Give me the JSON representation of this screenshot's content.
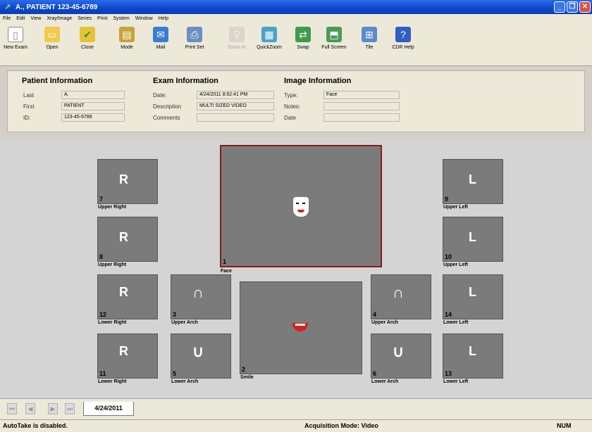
{
  "window": {
    "title": "A., PATIENT 123-45-6789"
  },
  "menu": [
    "File",
    "Edit",
    "View",
    "Xray/Image",
    "Series",
    "Print",
    "System",
    "Window",
    "Help"
  ],
  "toolbar": [
    {
      "label": "New Exam",
      "icon": "new-exam-icon"
    },
    {
      "label": "Open",
      "icon": "open-folder-icon"
    },
    {
      "label": "Close",
      "icon": "close-folder-icon"
    },
    {
      "label": "Mode",
      "icon": "mode-icon"
    },
    {
      "label": "Mail",
      "icon": "mail-icon"
    },
    {
      "label": "Print Set",
      "icon": "printer-icon"
    },
    {
      "label": "Zoom In",
      "icon": "zoom-in-icon"
    },
    {
      "label": "QuickZoom",
      "icon": "quickzoom-icon"
    },
    {
      "label": "Swap",
      "icon": "swap-icon"
    },
    {
      "label": "Full Screen",
      "icon": "full-screen-icon"
    },
    {
      "label": "Tile",
      "icon": "tile-icon"
    },
    {
      "label": "CDR Help",
      "icon": "help-icon"
    }
  ],
  "patient": {
    "title": "Patient Information",
    "last_label": "Last",
    "last": "A.",
    "first_label": "First",
    "first": "PATIENT",
    "id_label": "ID:",
    "id": "123-45-6789"
  },
  "exam": {
    "title": "Exam Information",
    "date_label": "Date:",
    "date": "4/24/2011 8:52:41 PM",
    "desc_label": "Description",
    "desc": "MULTI SIZED VIDEO",
    "comments_label": "Comments",
    "comments": ""
  },
  "image": {
    "title": "Image Information",
    "type_label": "Type:",
    "type": "Face",
    "notes_label": "Notes:",
    "notes": "",
    "date_label": "Date",
    "date": ""
  },
  "tiles": [
    {
      "num": "7",
      "label": "Upper Right",
      "glyph": "R"
    },
    {
      "num": "8",
      "label": "Upper Right",
      "glyph": "R"
    },
    {
      "num": "12",
      "label": "Lower Right",
      "glyph": "R"
    },
    {
      "num": "11",
      "label": "Lower Right",
      "glyph": "R"
    },
    {
      "num": "3",
      "label": "Upper Arch",
      "glyph": "∩"
    },
    {
      "num": "5",
      "label": "Lower Arch",
      "glyph": "∪"
    },
    {
      "num": "1",
      "label": "Face",
      "glyph": ""
    },
    {
      "num": "2",
      "label": "Smile",
      "glyph": ""
    },
    {
      "num": "4",
      "label": "Upper Arch",
      "glyph": "∩"
    },
    {
      "num": "6",
      "label": "Lower Arch",
      "glyph": "∪"
    },
    {
      "num": "9",
      "label": "Upper Left",
      "glyph": "L"
    },
    {
      "num": "10",
      "label": "Upper Left",
      "glyph": "L"
    },
    {
      "num": "14",
      "label": "Lower Left",
      "glyph": "L"
    },
    {
      "num": "13",
      "label": "Lower Left",
      "glyph": "L"
    }
  ],
  "tabs": {
    "active": "4/24/2011"
  },
  "status": {
    "autotake": "AutoTake is disabled.",
    "acquisition": "Acquisition Mode: Video",
    "num": "NUM"
  },
  "colors": {
    "title_bar": "#0a47c9",
    "selected_border": "#8a1a1a",
    "tile": "#7b7b7b"
  }
}
